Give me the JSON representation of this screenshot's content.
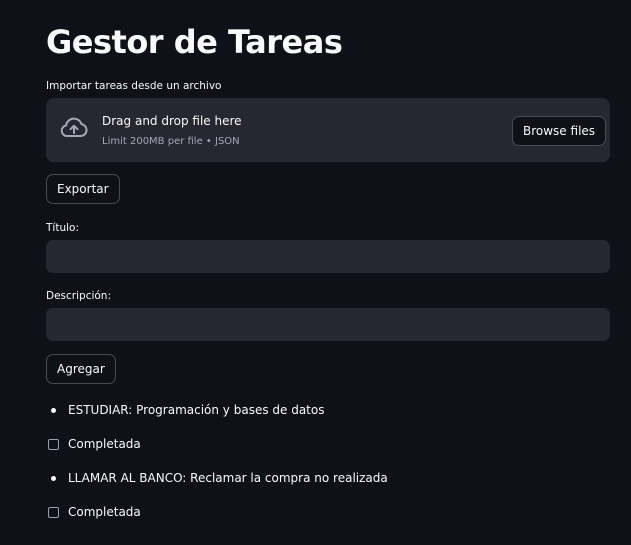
{
  "page": {
    "title": "Gestor de Tareas"
  },
  "uploader": {
    "label": "Importar tareas desde un archivo",
    "drop_text": "Drag and drop file here",
    "limit_text": "Limit 200MB per file • JSON",
    "browse_label": "Browse files",
    "icon": "cloud-upload-icon"
  },
  "export_button": "Exportar",
  "form": {
    "title_label": "Título:",
    "title_value": "",
    "description_label": "Descripción:",
    "description_value": "",
    "add_button": "Agregar"
  },
  "tasks": [
    {
      "text": "ESTUDIAR: Programación y bases de datos",
      "checkbox_label": "Completada",
      "completed": false
    },
    {
      "text": "LLAMAR AL BANCO: Reclamar la compra no realizada",
      "checkbox_label": "Completada",
      "completed": false
    }
  ],
  "colors": {
    "background": "#0e1117",
    "surface": "#262730",
    "text": "#fafafa",
    "muted": "#a3a8b8"
  }
}
